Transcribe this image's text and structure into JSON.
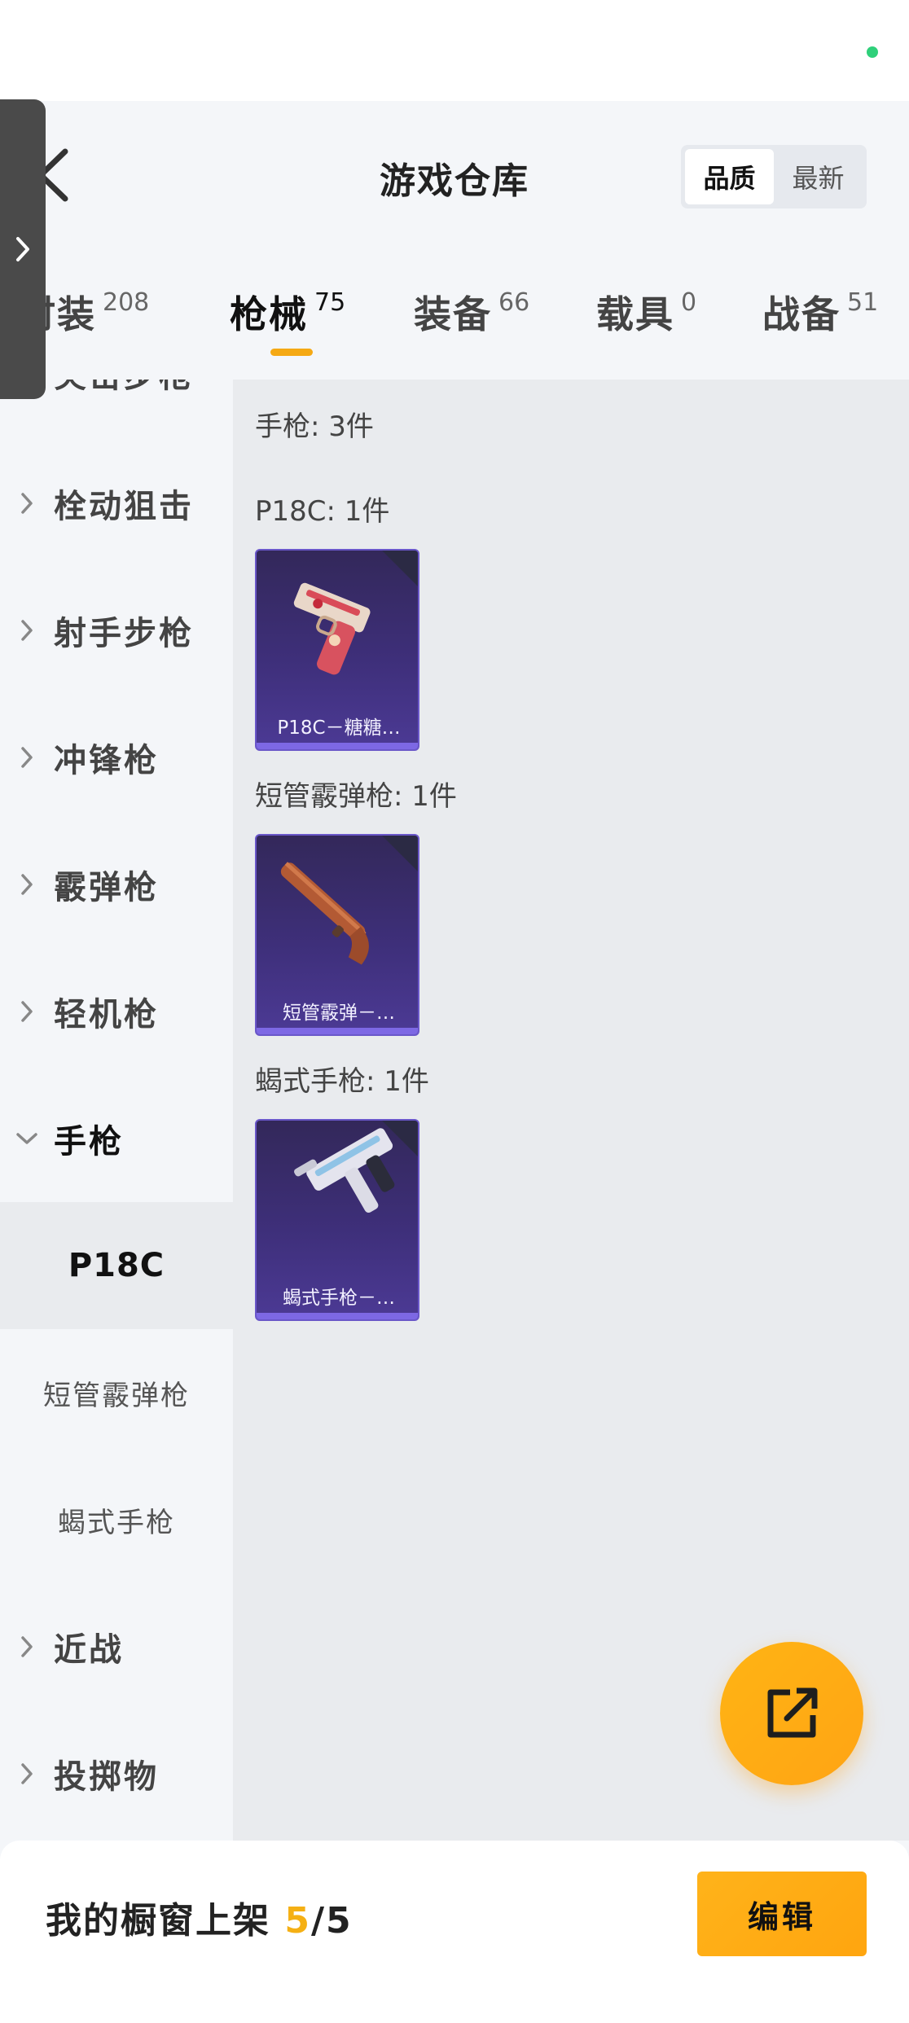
{
  "header": {
    "title": "游戏仓库",
    "sort_options": [
      "品质",
      "最新"
    ],
    "sort_selected": "品质"
  },
  "tabs": [
    {
      "label": "时装",
      "count": "208"
    },
    {
      "label": "枪械",
      "count": "75"
    },
    {
      "label": "装备",
      "count": "66"
    },
    {
      "label": "载具",
      "count": "0"
    },
    {
      "label": "战备",
      "count": "51"
    }
  ],
  "active_tab": "枪械",
  "sidebar": {
    "partial_top_label": "突击步枪",
    "categories": [
      "栓动狙击",
      "射手步枪",
      "冲锋枪",
      "霰弹枪",
      "轻机枪",
      "手枪"
    ],
    "open_category": "手枪",
    "subcategories": [
      "P18C",
      "短管霰弹枪",
      "蝎式手枪"
    ],
    "active_sub": "P18C",
    "categories_after": [
      "近战",
      "投掷物"
    ]
  },
  "content": {
    "group_header": "手枪: 3件",
    "sections": [
      {
        "header": "P18C: 1件",
        "items": [
          {
            "name": "P18C－糖糖…",
            "art": "red-pistol"
          }
        ]
      },
      {
        "header": "短管霰弹枪: 1件",
        "items": [
          {
            "name": "短管霰弹－…",
            "art": "sawed-off-shotgun"
          }
        ]
      },
      {
        "header": "蝎式手枪: 1件",
        "items": [
          {
            "name": "蝎式手枪－…",
            "art": "scorpion-pistol"
          }
        ]
      }
    ]
  },
  "footer": {
    "showcase_label": "我的橱窗上架",
    "showcase_used": "5",
    "showcase_total": "/5",
    "edit_label": "编辑"
  },
  "colors": {
    "accent": "#f5a914",
    "card_purple": "#3e2f7a",
    "status_dot": "#2fd07a"
  }
}
